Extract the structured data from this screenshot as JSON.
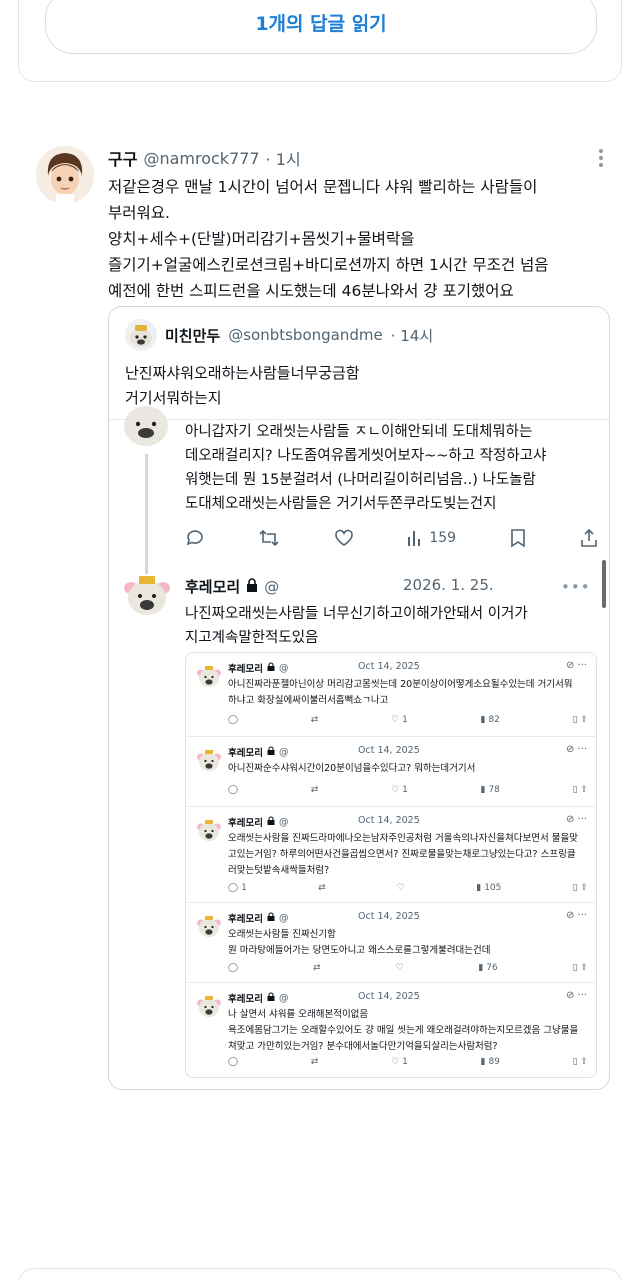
{
  "read_replies": {
    "label": "1개의 답글 읽기"
  },
  "tweet": {
    "name": "구구",
    "handle": "@namrock777",
    "time": "· 1시",
    "lines": [
      "저같은경우 맨날 1시간이 넘어서 문젭니다 샤워 빨리하는 사람들이",
      "부러워요.",
      "양치+세수+(단발)머리감기+몸씻기+물벼락을",
      "즐기기+얼굴에스킨로션크림+바디로션까지 하면 1시간 무조건 넘음",
      "예전에 한번 스피드런을 시도했는데 46분나와서 걍 포기했어요"
    ]
  },
  "quote": {
    "name": "미친만두",
    "handle": "@sonbtsbongandme",
    "time": "· 14시",
    "lines": [
      "난진짜샤워오래하는사람들너무궁금함",
      "거기서뭐하는지"
    ]
  },
  "shot": {
    "reply1_lines": [
      "아니갑자기 오래씻는사람들 ㅈㄴ이해안되네 도대체뭐하는",
      "데오래걸리지? 나도좀여유롭게씻어보자~~하고 작정하고샤",
      "워햇는데 뭔 15분걸려서 (나머리길이허리넘음..) 나도놀람",
      "도대체오래씻는사람들은 거기서두쫀쿠라도빚는건지"
    ],
    "reply1_views": "159",
    "reply2": {
      "name": "후레모리",
      "handle": "@",
      "date": "2026. 1. 25.",
      "lines": [
        "나진짜오래씻는사람들 너무신기하고이해가안돼서 이거가",
        "지고계속말한적도있음"
      ]
    },
    "mini_items": [
      {
        "name": "후레모리",
        "handle": "@",
        "date": "Oct 14, 2025",
        "lines": [
          "아니진짜라푼젤아닌이상 머리감고몸씻는데 20분이상이어떻게소요될수있는데 거기서뭐",
          "하냐고 화장실에싸이불러서흠뻑쇼ㄱ나고"
        ],
        "likes": "1",
        "views": "82"
      },
      {
        "name": "후레모리",
        "handle": "@",
        "date": "Oct 14, 2025",
        "lines": [
          "아니진짜순수샤워시간이20분이넘을수있다고? 뭐하는데거기서"
        ],
        "likes": "1",
        "views": "78"
      },
      {
        "name": "후레모리",
        "handle": "@",
        "date": "Oct 14, 2025",
        "lines": [
          "오래씻는사람을 진짜드라마에나오는남자주인공처럼 거울속의나자신을쳐다보면서 물을맞",
          "고있는거임? 하루의어떤사건을곱씹으면서? 진짜로물을맞는채로그냥있는다고? 스프링클",
          "러맞는텃밭속새싹들처럼?"
        ],
        "retweets_label": "1",
        "views": "105"
      },
      {
        "name": "후레모리",
        "handle": "@",
        "date": "Oct 14, 2025",
        "lines": [
          "오래씻는사람들 진짜신기함",
          "뭔 마라탕에들어가는 당면도아니고 왜스스로를그렇게불려대는건데"
        ],
        "views": "76"
      },
      {
        "name": "후레모리",
        "handle": "@",
        "date": "Oct 14, 2025",
        "lines": [
          "나 살면서 샤워를 오래해본적이없음",
          "욕조에몸담그기는 오래할수있어도 걍 매일 씻는게 왜오래걸려야하는지모르겠음 그냥물을",
          "쳐맞고 가만히있는거임? 분수대에서놀다만기억을되살리는사람처럼?"
        ],
        "likes": "1",
        "views": "89"
      }
    ]
  }
}
